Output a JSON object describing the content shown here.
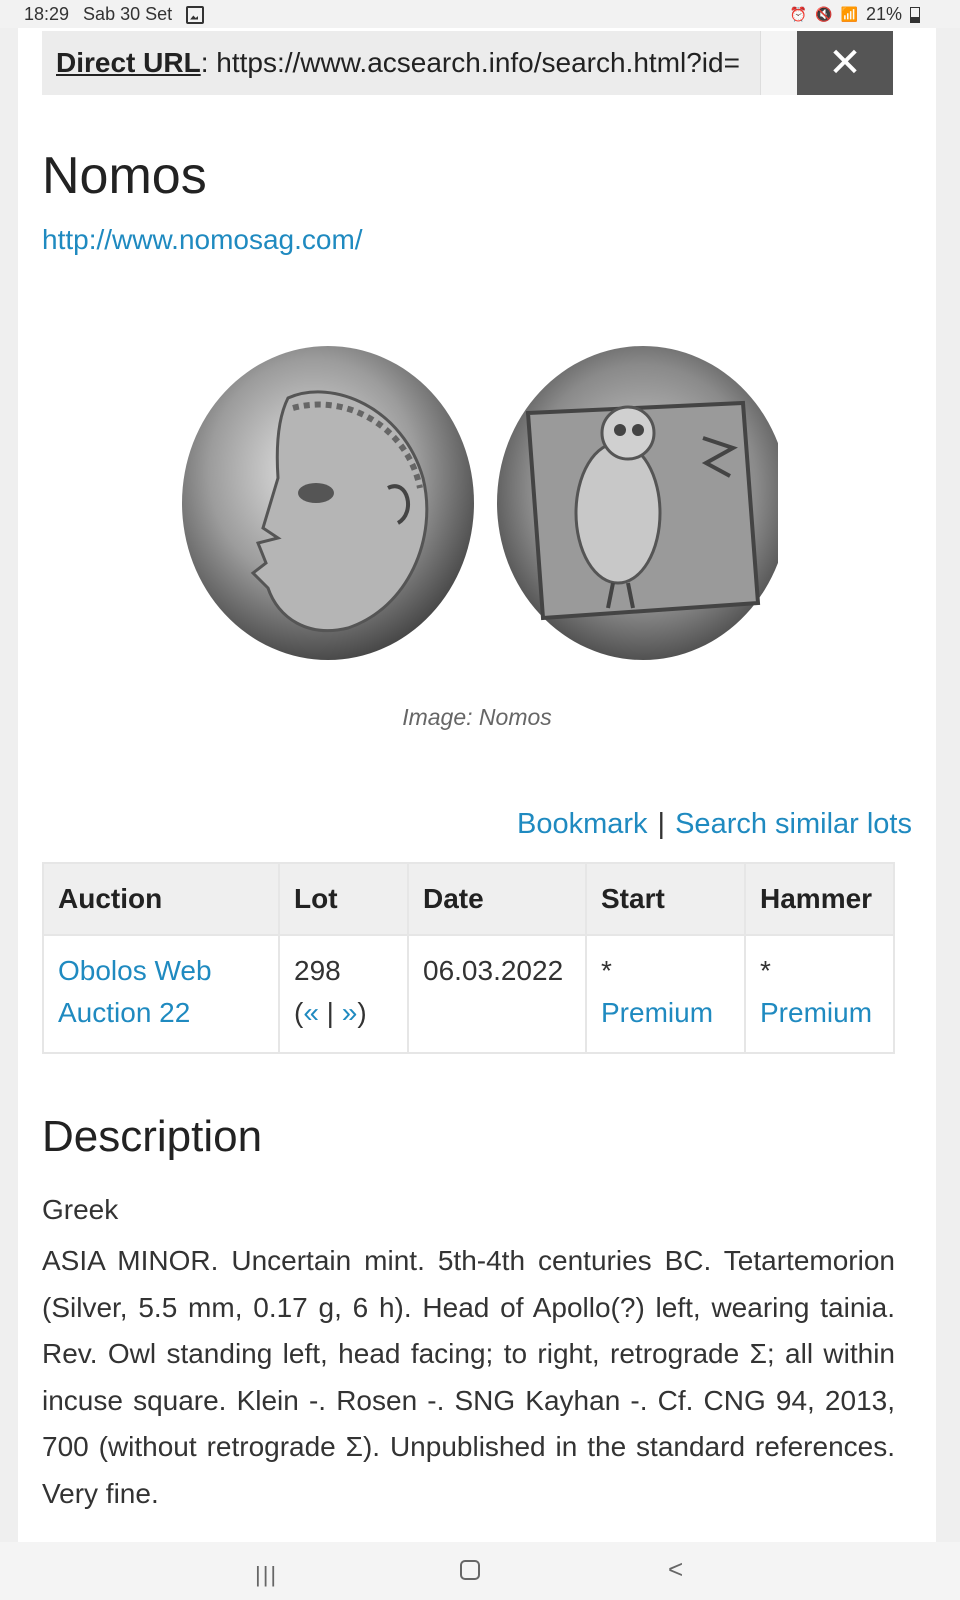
{
  "status": {
    "time": "18:29",
    "date": "Sab 30 Set",
    "battery": "21%"
  },
  "url_bar": {
    "label": "Direct URL",
    "value": "https://www.acsearch.info/search.html?id=",
    "close_symbol": "✕"
  },
  "seller": {
    "name": "Nomos",
    "url": "http://www.nomosag.com/"
  },
  "image": {
    "caption": "Image: Nomos"
  },
  "actions": {
    "bookmark": "Bookmark",
    "separator": "|",
    "search_similar": "Search similar lots"
  },
  "table": {
    "headers": [
      "Auction",
      "Lot",
      "Date",
      "Start",
      "Hammer"
    ],
    "row": {
      "auction": "Obolos Web Auction 22",
      "lot": "298",
      "lot_open": "(",
      "lot_prev": "«",
      "lot_sep": " | ",
      "lot_next": "»",
      "lot_close": ")",
      "date": "06.03.2022",
      "start_star": "*",
      "start_link": "Premium",
      "hammer_star": "*",
      "hammer_link": "Premium"
    }
  },
  "description": {
    "title": "Description",
    "category": "Greek",
    "text": "ASIA MINOR. Uncertain mint. 5th-4th centuries BC. Tetartemorion (Silver, 5.5 mm, 0.17 g, 6 h). Head of Apollo(?) left, wearing tainia. Rev. Owl standing left, head facing; to right, retrograde Σ; all within incuse square. Klein -. Rosen -. SNG Kayhan -. Cf. CNG 94, 2013, 700 (without retrograde Σ). Unpublished in the standard references. Very fine."
  },
  "colors": {
    "link": "#1f8ac0",
    "close_button": "#555555",
    "url_bar_bg": "#ececec"
  }
}
